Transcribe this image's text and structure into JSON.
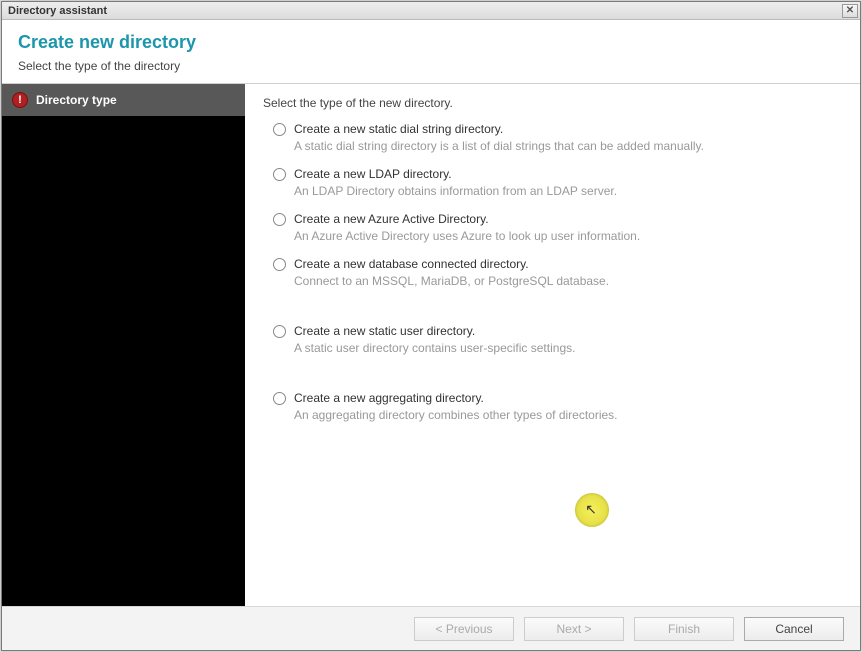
{
  "window": {
    "title": "Directory assistant"
  },
  "header": {
    "title": "Create new directory",
    "subtitle": "Select the type of the directory"
  },
  "sidebar": {
    "items": [
      {
        "label": "Directory type"
      }
    ]
  },
  "content": {
    "heading": "Select the type of the new directory.",
    "options": [
      {
        "label": "Create a new static dial string directory.",
        "desc": "A static dial string directory is a list of dial strings that can be added manually."
      },
      {
        "label": "Create a new LDAP directory.",
        "desc": "An LDAP Directory obtains information from an LDAP server."
      },
      {
        "label": "Create a new Azure Active Directory.",
        "desc": "An Azure Active Directory uses Azure to look up user information."
      },
      {
        "label": "Create a new database connected directory.",
        "desc": "Connect to an MSSQL, MariaDB, or PostgreSQL database."
      },
      {
        "label": "Create a new static user directory.",
        "desc": "A static user directory contains user-specific settings."
      },
      {
        "label": "Create a new aggregating directory.",
        "desc": "An aggregating directory combines other types of directories."
      }
    ]
  },
  "footer": {
    "previous": "< Previous",
    "next": "Next >",
    "finish": "Finish",
    "cancel": "Cancel"
  }
}
